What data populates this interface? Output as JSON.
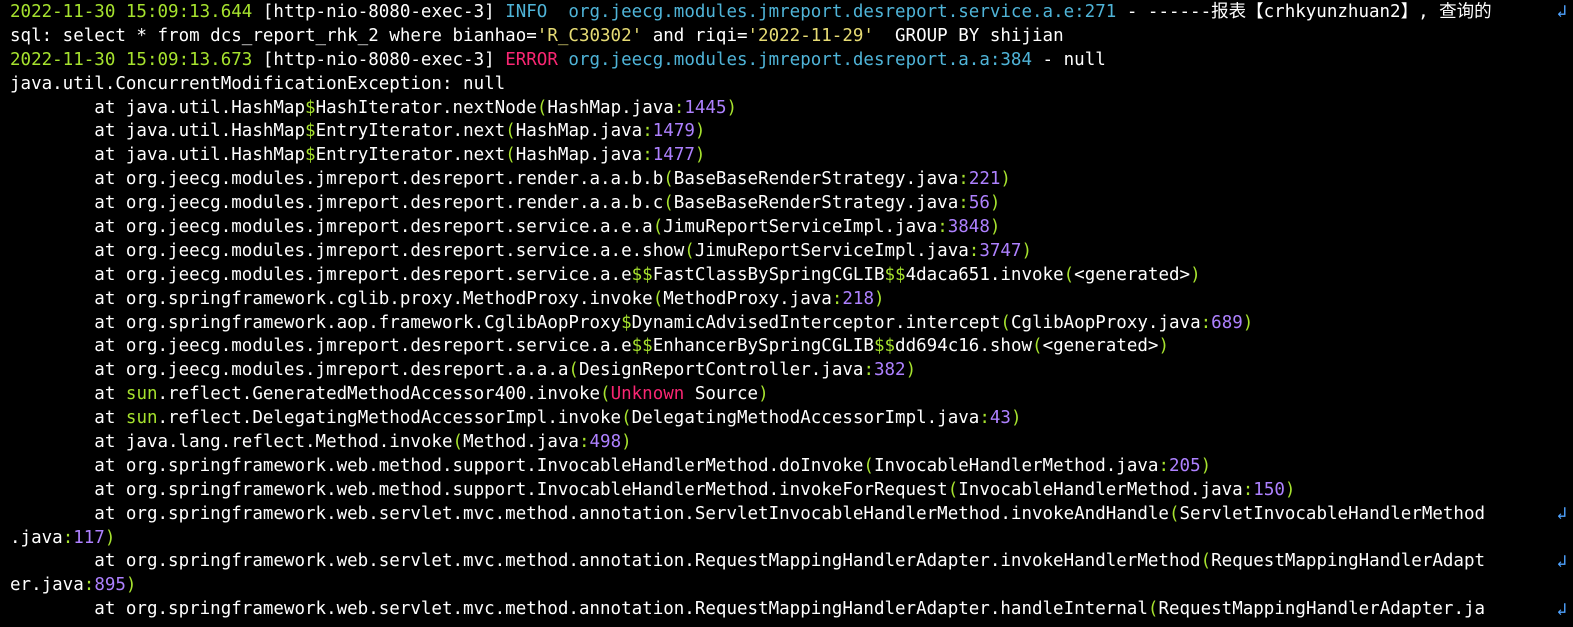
{
  "colors": {
    "background": "#000000",
    "text": "#ffffff",
    "timestamp": "#a6e22e",
    "level_info": "#4fb4d8",
    "level_error": "#f92672",
    "logger": "#4fb4d8",
    "number": "#ae81ff",
    "paren": "#a6e22e",
    "wrap_marker": "#4fa3ff"
  },
  "lines": [
    [
      {
        "t": "2022-11-30 15:09:13.644 ",
        "c": "lime"
      },
      {
        "t": "[http-nio-8080-exec-3] ",
        "c": "white"
      },
      {
        "t": "INFO  ",
        "c": "cyan"
      },
      {
        "t": "org.jeecg.modules.jmreport.desreport.service.a.e:271",
        "c": "cyan"
      },
      {
        "t": " - ------报表【crhkyunzhuan2】, 查询的",
        "c": "white"
      }
    ],
    [
      {
        "t": "sql: select * from dcs_report_rhk_2 where bianhao=",
        "c": "white"
      },
      {
        "t": "'R_C30302'",
        "c": "yellow"
      },
      {
        "t": " and riqi=",
        "c": "white"
      },
      {
        "t": "'2022-11-29'",
        "c": "yellow"
      },
      {
        "t": "  GROUP BY shijian",
        "c": "white"
      }
    ],
    [
      {
        "t": "2022-11-30 15:09:13.673 ",
        "c": "lime"
      },
      {
        "t": "[http-nio-8080-exec-3] ",
        "c": "white"
      },
      {
        "t": "ERROR ",
        "c": "red"
      },
      {
        "t": "org.jeecg.modules.jmreport.desreport.a.a:384",
        "c": "cyan"
      },
      {
        "t": " - null",
        "c": "white"
      }
    ],
    [
      {
        "t": "java.util.ConcurrentModificationException",
        "c": "white"
      },
      {
        "t": ": null",
        "c": "white"
      }
    ],
    [
      {
        "t": "        at java.util.HashMap",
        "c": "white"
      },
      {
        "t": "$",
        "c": "lime"
      },
      {
        "t": "HashIterator.nextNode",
        "c": "white"
      },
      {
        "t": "(",
        "c": "lime"
      },
      {
        "t": "HashMap.java",
        "c": "white"
      },
      {
        "t": ":",
        "c": "lime"
      },
      {
        "t": "1445",
        "c": "purple"
      },
      {
        "t": ")",
        "c": "lime"
      }
    ],
    [
      {
        "t": "        at java.util.HashMap",
        "c": "white"
      },
      {
        "t": "$",
        "c": "lime"
      },
      {
        "t": "EntryIterator.next",
        "c": "white"
      },
      {
        "t": "(",
        "c": "lime"
      },
      {
        "t": "HashMap.java",
        "c": "white"
      },
      {
        "t": ":",
        "c": "lime"
      },
      {
        "t": "1479",
        "c": "purple"
      },
      {
        "t": ")",
        "c": "lime"
      }
    ],
    [
      {
        "t": "        at java.util.HashMap",
        "c": "white"
      },
      {
        "t": "$",
        "c": "lime"
      },
      {
        "t": "EntryIterator.next",
        "c": "white"
      },
      {
        "t": "(",
        "c": "lime"
      },
      {
        "t": "HashMap.java",
        "c": "white"
      },
      {
        "t": ":",
        "c": "lime"
      },
      {
        "t": "1477",
        "c": "purple"
      },
      {
        "t": ")",
        "c": "lime"
      }
    ],
    [
      {
        "t": "        at org.jeecg.modules.jmreport.desreport.render.a.a.b.b",
        "c": "white"
      },
      {
        "t": "(",
        "c": "lime"
      },
      {
        "t": "BaseBaseRenderStrategy.java",
        "c": "white"
      },
      {
        "t": ":",
        "c": "lime"
      },
      {
        "t": "221",
        "c": "purple"
      },
      {
        "t": ")",
        "c": "lime"
      }
    ],
    [
      {
        "t": "        at org.jeecg.modules.jmreport.desreport.render.a.a.b.c",
        "c": "white"
      },
      {
        "t": "(",
        "c": "lime"
      },
      {
        "t": "BaseBaseRenderStrategy.java",
        "c": "white"
      },
      {
        "t": ":",
        "c": "lime"
      },
      {
        "t": "56",
        "c": "purple"
      },
      {
        "t": ")",
        "c": "lime"
      }
    ],
    [
      {
        "t": "        at org.jeecg.modules.jmreport.desreport.service.a.e.a",
        "c": "white"
      },
      {
        "t": "(",
        "c": "lime"
      },
      {
        "t": "JimuReportServiceImpl.java",
        "c": "white"
      },
      {
        "t": ":",
        "c": "lime"
      },
      {
        "t": "3848",
        "c": "purple"
      },
      {
        "t": ")",
        "c": "lime"
      }
    ],
    [
      {
        "t": "        at org.jeecg.modules.jmreport.desreport.service.a.e.show",
        "c": "white"
      },
      {
        "t": "(",
        "c": "lime"
      },
      {
        "t": "JimuReportServiceImpl.java",
        "c": "white"
      },
      {
        "t": ":",
        "c": "lime"
      },
      {
        "t": "3747",
        "c": "purple"
      },
      {
        "t": ")",
        "c": "lime"
      }
    ],
    [
      {
        "t": "        at org.jeecg.modules.jmreport.desreport.service.a.e",
        "c": "white"
      },
      {
        "t": "$$",
        "c": "lime"
      },
      {
        "t": "FastClassBySpringCGLIB",
        "c": "white"
      },
      {
        "t": "$$",
        "c": "lime"
      },
      {
        "t": "4daca651.invoke",
        "c": "white"
      },
      {
        "t": "(",
        "c": "lime"
      },
      {
        "t": "<generated>",
        "c": "white"
      },
      {
        "t": ")",
        "c": "lime"
      }
    ],
    [
      {
        "t": "        at org.springframework.cglib.proxy.MethodProxy.invoke",
        "c": "white"
      },
      {
        "t": "(",
        "c": "lime"
      },
      {
        "t": "MethodProxy.java",
        "c": "white"
      },
      {
        "t": ":",
        "c": "lime"
      },
      {
        "t": "218",
        "c": "purple"
      },
      {
        "t": ")",
        "c": "lime"
      }
    ],
    [
      {
        "t": "        at org.springframework.aop.framework.CglibAopProxy",
        "c": "white"
      },
      {
        "t": "$",
        "c": "lime"
      },
      {
        "t": "DynamicAdvisedInterceptor.intercept",
        "c": "white"
      },
      {
        "t": "(",
        "c": "lime"
      },
      {
        "t": "CglibAopProxy.java",
        "c": "white"
      },
      {
        "t": ":",
        "c": "lime"
      },
      {
        "t": "689",
        "c": "purple"
      },
      {
        "t": ")",
        "c": "lime"
      }
    ],
    [
      {
        "t": "        at org.jeecg.modules.jmreport.desreport.service.a.e",
        "c": "white"
      },
      {
        "t": "$$",
        "c": "lime"
      },
      {
        "t": "EnhancerBySpringCGLIB",
        "c": "white"
      },
      {
        "t": "$$",
        "c": "lime"
      },
      {
        "t": "dd694c16.show",
        "c": "white"
      },
      {
        "t": "(",
        "c": "lime"
      },
      {
        "t": "<generated>",
        "c": "white"
      },
      {
        "t": ")",
        "c": "lime"
      }
    ],
    [
      {
        "t": "        at org.jeecg.modules.jmreport.desreport.a.a.a",
        "c": "white"
      },
      {
        "t": "(",
        "c": "lime"
      },
      {
        "t": "DesignReportController.java",
        "c": "white"
      },
      {
        "t": ":",
        "c": "lime"
      },
      {
        "t": "382",
        "c": "purple"
      },
      {
        "t": ")",
        "c": "lime"
      }
    ],
    [
      {
        "t": "        at ",
        "c": "white"
      },
      {
        "t": "sun",
        "c": "lime"
      },
      {
        "t": ".reflect.GeneratedMethodAccessor400.invoke",
        "c": "white"
      },
      {
        "t": "(",
        "c": "lime"
      },
      {
        "t": "Unknown",
        "c": "red"
      },
      {
        "t": " Source",
        "c": "white"
      },
      {
        "t": ")",
        "c": "lime"
      }
    ],
    [
      {
        "t": "        at ",
        "c": "white"
      },
      {
        "t": "sun",
        "c": "lime"
      },
      {
        "t": ".reflect.DelegatingMethodAccessorImpl.invoke",
        "c": "white"
      },
      {
        "t": "(",
        "c": "lime"
      },
      {
        "t": "DelegatingMethodAccessorImpl.java",
        "c": "white"
      },
      {
        "t": ":",
        "c": "lime"
      },
      {
        "t": "43",
        "c": "purple"
      },
      {
        "t": ")",
        "c": "lime"
      }
    ],
    [
      {
        "t": "        at java.lang.reflect.Method.invoke",
        "c": "white"
      },
      {
        "t": "(",
        "c": "lime"
      },
      {
        "t": "Method.java",
        "c": "white"
      },
      {
        "t": ":",
        "c": "lime"
      },
      {
        "t": "498",
        "c": "purple"
      },
      {
        "t": ")",
        "c": "lime"
      }
    ],
    [
      {
        "t": "        at org.springframework.web.method.support.InvocableHandlerMethod.doInvoke",
        "c": "white"
      },
      {
        "t": "(",
        "c": "lime"
      },
      {
        "t": "InvocableHandlerMethod.java",
        "c": "white"
      },
      {
        "t": ":",
        "c": "lime"
      },
      {
        "t": "205",
        "c": "purple"
      },
      {
        "t": ")",
        "c": "lime"
      }
    ],
    [
      {
        "t": "        at org.springframework.web.method.support.InvocableHandlerMethod.invokeForRequest",
        "c": "white"
      },
      {
        "t": "(",
        "c": "lime"
      },
      {
        "t": "InvocableHandlerMethod.java",
        "c": "white"
      },
      {
        "t": ":",
        "c": "lime"
      },
      {
        "t": "150",
        "c": "purple"
      },
      {
        "t": ")",
        "c": "lime"
      }
    ],
    [
      {
        "t": "        at org.springframework.web.servlet.mvc.method.annotation.ServletInvocableHandlerMethod.invokeAndHandle",
        "c": "white"
      },
      {
        "t": "(",
        "c": "lime"
      },
      {
        "t": "ServletInvocableHandlerMethod",
        "c": "white"
      }
    ],
    [
      {
        "t": ".java",
        "c": "white"
      },
      {
        "t": ":",
        "c": "lime"
      },
      {
        "t": "117",
        "c": "purple"
      },
      {
        "t": ")",
        "c": "lime"
      }
    ],
    [
      {
        "t": "        at org.springframework.web.servlet.mvc.method.annotation.RequestMappingHandlerAdapter.invokeHandlerMethod",
        "c": "white"
      },
      {
        "t": "(",
        "c": "lime"
      },
      {
        "t": "RequestMappingHandlerAdapt",
        "c": "white"
      }
    ],
    [
      {
        "t": "er.java",
        "c": "white"
      },
      {
        "t": ":",
        "c": "lime"
      },
      {
        "t": "895",
        "c": "purple"
      },
      {
        "t": ")",
        "c": "lime"
      }
    ],
    [
      {
        "t": "        at org.springframework.web.servlet.mvc.method.annotation.RequestMappingHandlerAdapter.handleInternal",
        "c": "white"
      },
      {
        "t": "(",
        "c": "lime"
      },
      {
        "t": "RequestMappingHandlerAdapter.ja",
        "c": "white"
      }
    ]
  ],
  "wrapped_lines": [
    0,
    21,
    23,
    25
  ],
  "wrap_marker": "↲"
}
